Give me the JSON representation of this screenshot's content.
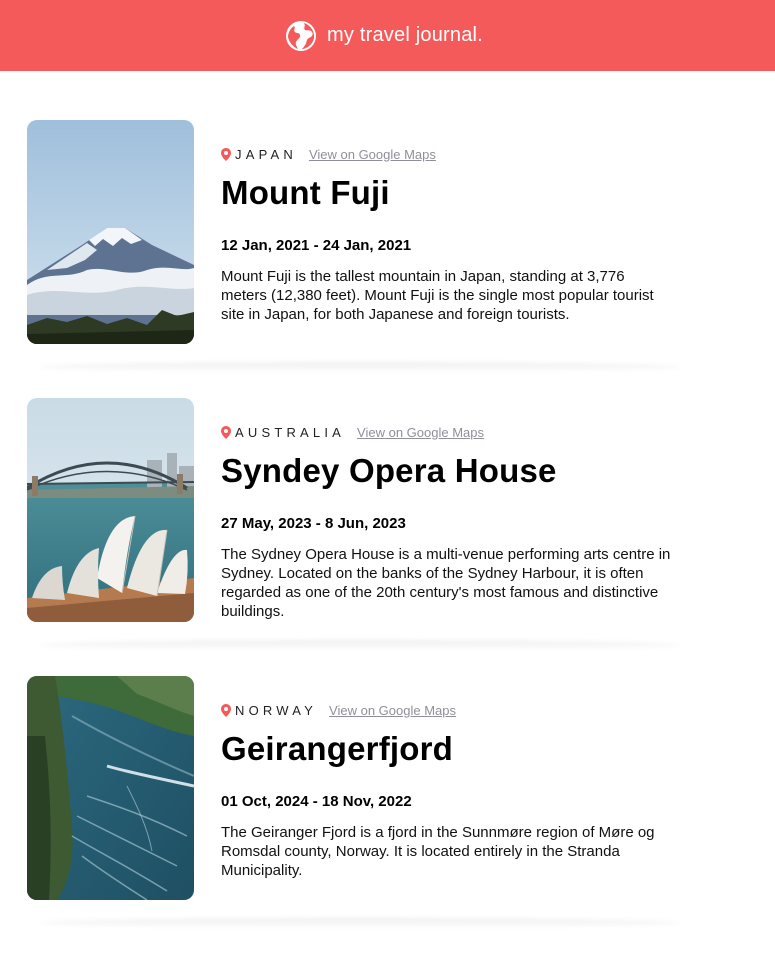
{
  "header": {
    "title": "my travel journal.",
    "icon": "globe-icon",
    "background": "#F55A5A"
  },
  "entries": [
    {
      "country": "JAPAN",
      "maps_link": "View on Google Maps",
      "title": "Mount Fuji",
      "dates": "12 Jan, 2021 - 24 Jan, 2021",
      "description": "Mount Fuji is the tallest mountain in Japan, standing at 3,776 meters (12,380 feet). Mount Fuji is the single most popular tourist site in Japan, for both Japanese and foreign tourists.",
      "image": "mount-fuji-photo"
    },
    {
      "country": "AUSTRALIA",
      "maps_link": "View on Google Maps",
      "title": "Syndey Opera House",
      "dates": "27 May, 2023 - 8 Jun, 2023",
      "description": "The Sydney Opera House is a multi-venue performing arts centre in Sydney. Located on the banks of the Sydney Harbour, it is often regarded as one of the 20th century's most famous and distinctive buildings.",
      "image": "sydney-opera-house-photo"
    },
    {
      "country": "NORWAY",
      "maps_link": "View on Google Maps",
      "title": "Geirangerfjord",
      "dates": "01 Oct, 2024 - 18 Nov, 2022",
      "description": "The Geiranger Fjord is a fjord in the Sunnmøre region of Møre og Romsdal county, Norway. It is located entirely in the Stranda Municipality.",
      "image": "geirangerfjord-photo"
    }
  ]
}
